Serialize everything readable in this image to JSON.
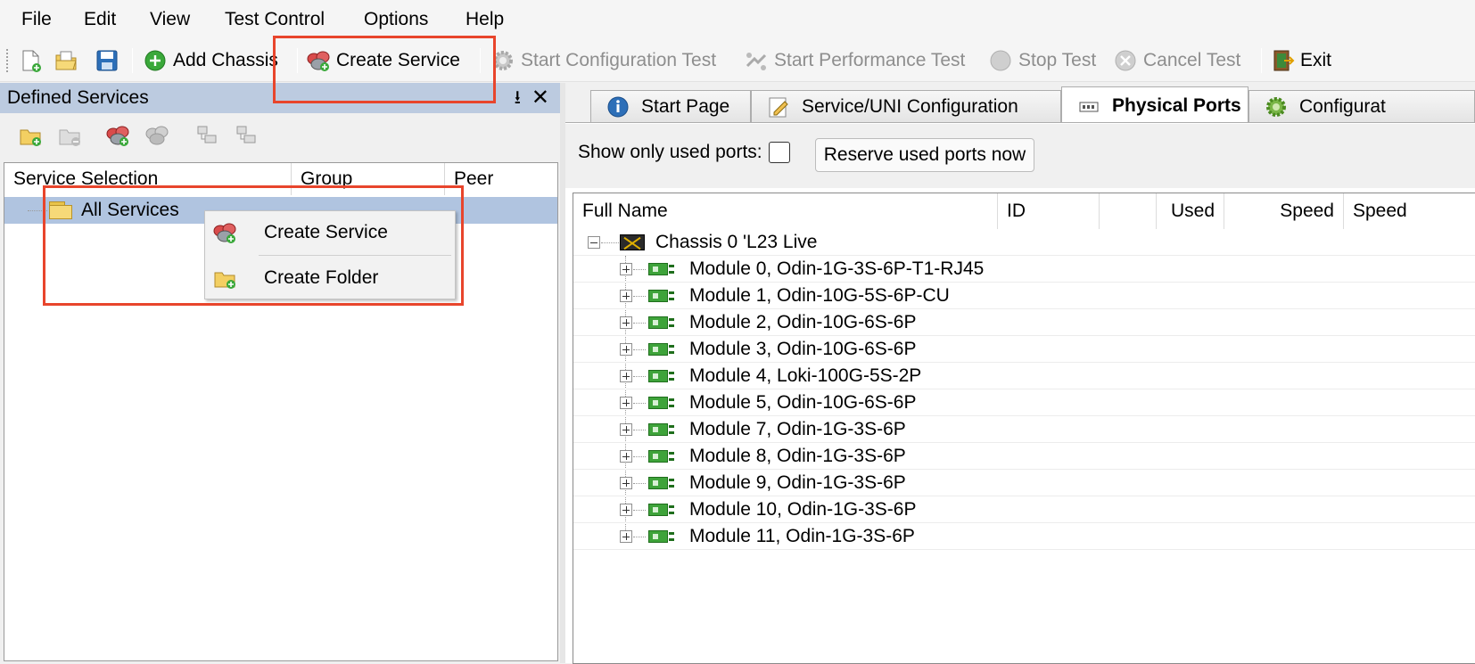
{
  "menu": [
    "File",
    "Edit",
    "View",
    "Test Control",
    "Options",
    "Help"
  ],
  "toolbar": {
    "add_chassis": "Add Chassis",
    "create_service": "Create Service",
    "start_configuration_test": "Start Configuration Test",
    "start_performance_test": "Start Performance Test",
    "stop_test": "Stop Test",
    "cancel_test": "Cancel Test",
    "exit": "Exit"
  },
  "left_pane": {
    "title": "Defined Services",
    "pin_glyph": "⭳",
    "close_glyph": "✕",
    "columns": [
      "Service Selection",
      "Group",
      "Peer"
    ],
    "tree_root": "All Services",
    "context_menu": [
      "Create Service",
      "Create Folder"
    ]
  },
  "tabs": [
    "Start Page",
    "Service/UNI Configuration",
    "Physical Ports",
    "Configurat"
  ],
  "active_tab": "Physical Ports",
  "ports": {
    "show_used_label": "Show only used ports:",
    "show_used_checked": false,
    "reserve_button": "Reserve used ports now",
    "columns": [
      "Full Name",
      "ID",
      "",
      "Used",
      "Speed",
      "Speed"
    ],
    "chassis": "Chassis 0 'L23 Live",
    "modules": [
      "Module 0, Odin-1G-3S-6P-T1-RJ45",
      "Module 1, Odin-10G-5S-6P-CU",
      "Module 2, Odin-10G-6S-6P",
      "Module 3, Odin-10G-6S-6P",
      "Module 4, Loki-100G-5S-2P",
      "Module 5, Odin-10G-6S-6P",
      "Module 7, Odin-1G-3S-6P",
      "Module 8, Odin-1G-3S-6P",
      "Module 9, Odin-1G-3S-6P",
      "Module 10, Odin-1G-3S-6P",
      "Module 11, Odin-1G-3S-6P"
    ]
  },
  "colors": {
    "highlight": "#e8452c",
    "selection": "#b0c4e0",
    "pane_title": "#bccbe0"
  }
}
